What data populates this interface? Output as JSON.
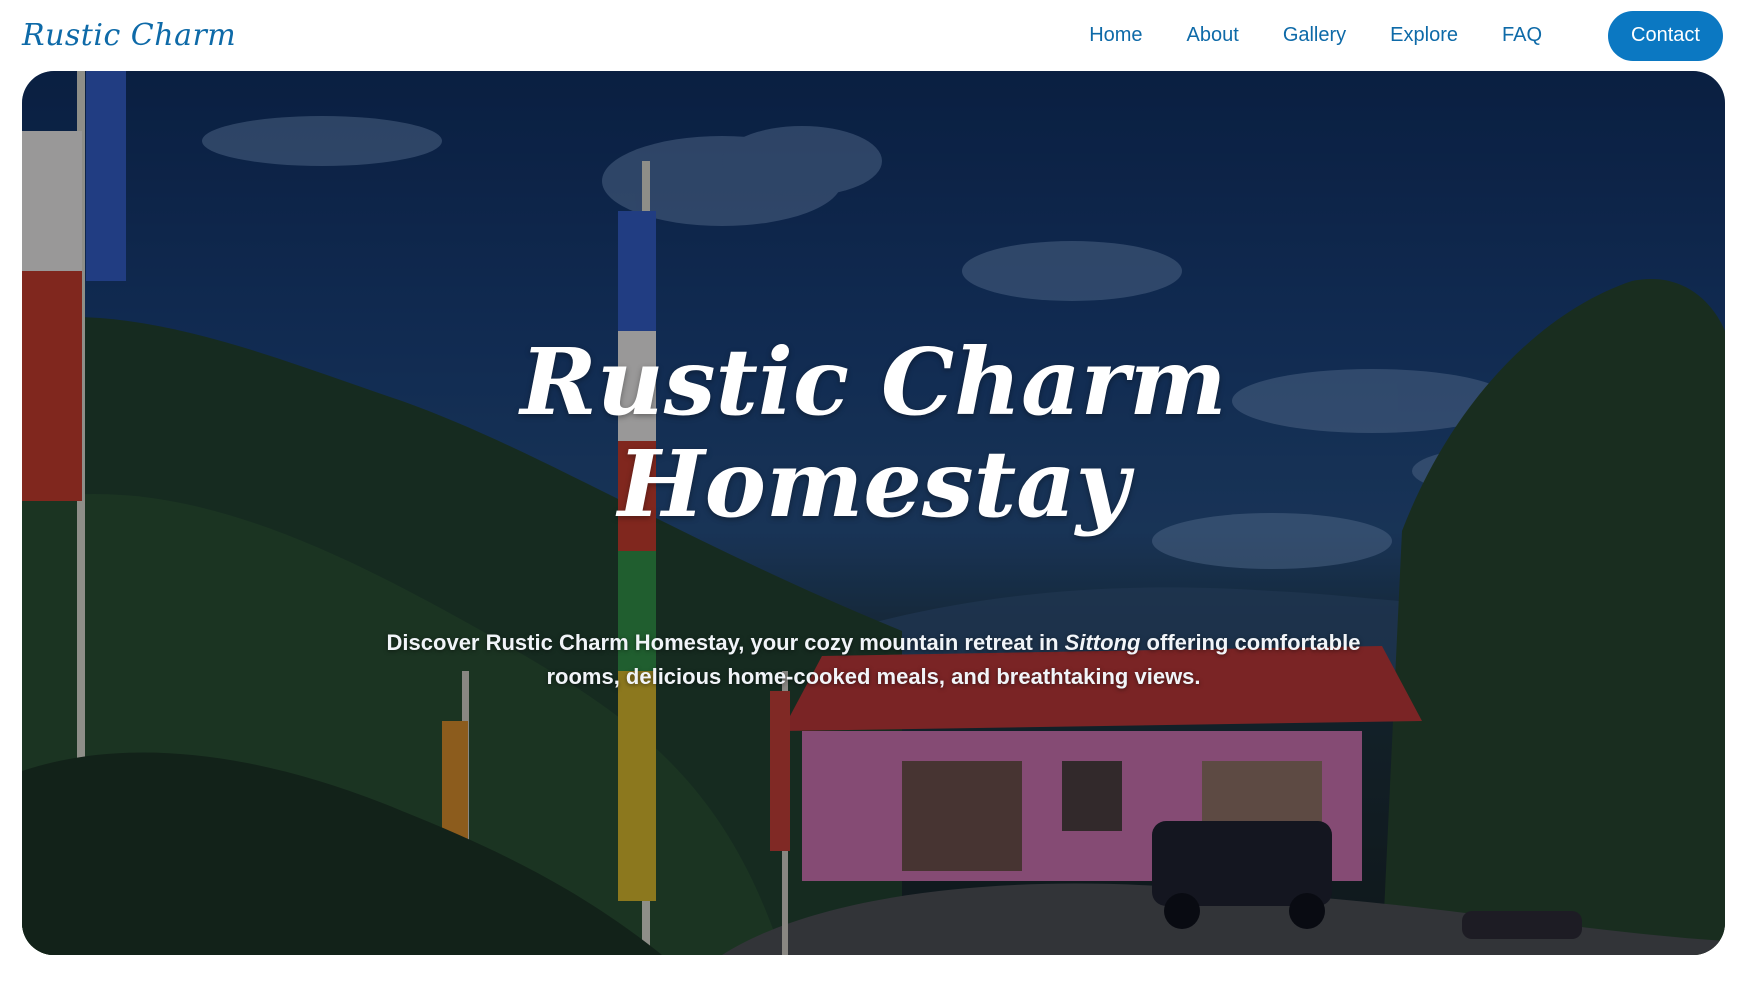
{
  "brand": {
    "name": "Rustic Charm"
  },
  "nav": {
    "items": [
      {
        "label": "Home"
      },
      {
        "label": "About"
      },
      {
        "label": "Gallery"
      },
      {
        "label": "Explore"
      },
      {
        "label": "FAQ"
      }
    ],
    "cta_label": "Contact"
  },
  "hero": {
    "title_line1": "Rustic Charm",
    "title_line2": "Homestay",
    "desc_before": "Discover Rustic Charm Homestay, your cozy mountain retreat in ",
    "desc_place": "Sittong",
    "desc_after": " offering comfortable rooms, delicious home-cooked meals, and breathtaking views.",
    "background_image": "mountain-homestay-photo"
  },
  "colors": {
    "brand": "#0e6aa8",
    "cta_bg": "#0b78c2",
    "roof": "#b8322a",
    "walls": "#d77fb7"
  }
}
